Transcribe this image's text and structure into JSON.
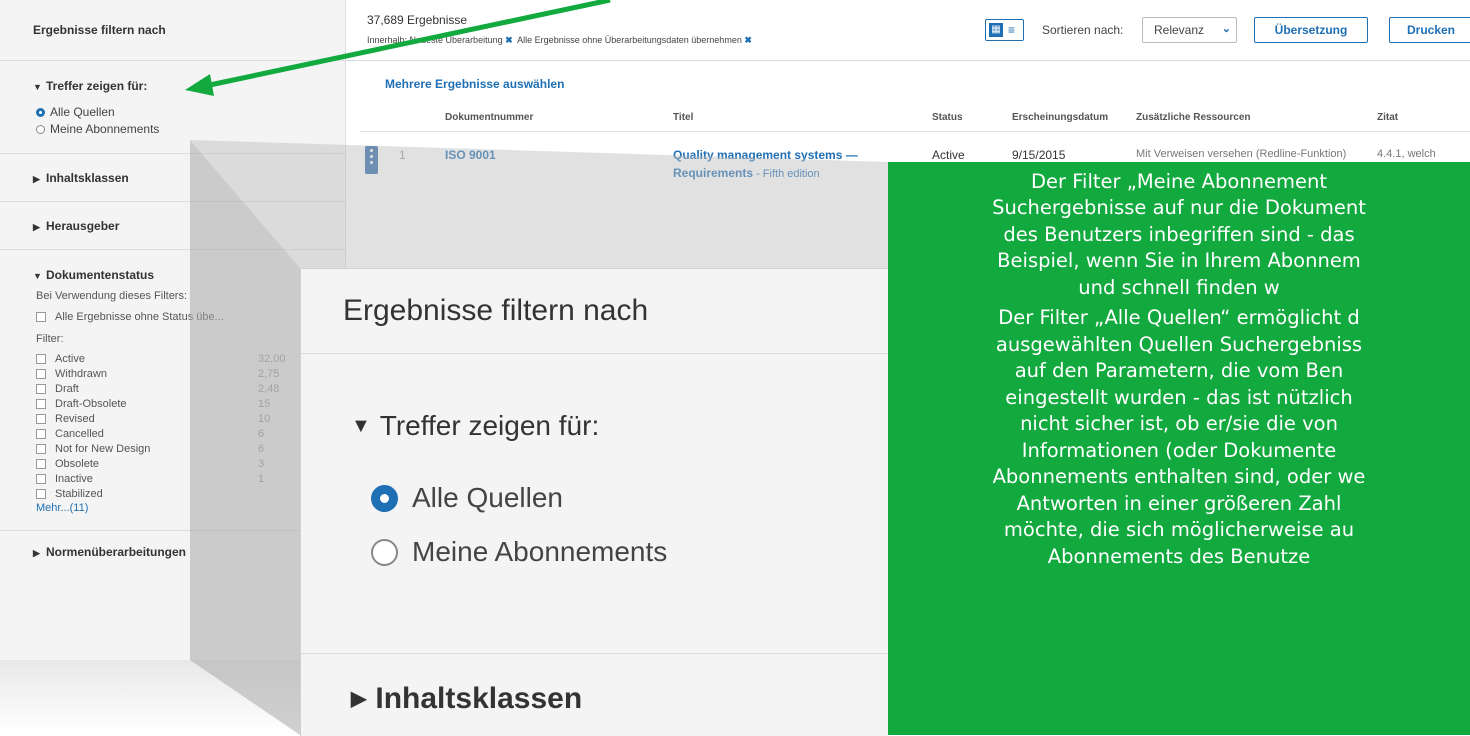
{
  "sidebar": {
    "title": "Ergebnisse filtern nach",
    "hits_section": "Treffer zeigen für:",
    "radio_all": "Alle Quellen",
    "radio_subs": "Meine Abonnements",
    "content_classes": "Inhaltsklassen",
    "publishers": "Herausgeber",
    "doc_status": "Dokumentenstatus",
    "filter_note": "Bei Verwendung dieses Filters:",
    "no_status": "Alle Ergebnisse ohne Status übe...",
    "filter_label": "Filter:",
    "status_items": [
      {
        "label": "Active",
        "count": "32,00"
      },
      {
        "label": "Withdrawn",
        "count": "2,75"
      },
      {
        "label": "Draft",
        "count": "2,48"
      },
      {
        "label": "Draft-Obsolete",
        "count": "15"
      },
      {
        "label": "Revised",
        "count": "10"
      },
      {
        "label": "Cancelled",
        "count": "6"
      },
      {
        "label": "Not for New Design",
        "count": "6"
      },
      {
        "label": "Obsolete",
        "count": "3"
      },
      {
        "label": "Inactive",
        "count": "1"
      },
      {
        "label": "Stabilized",
        "count": ""
      }
    ],
    "more": "Mehr...(11)",
    "revisions": "Normenüberarbeitungen"
  },
  "topbar": {
    "count": "37,689 Ergebnisse",
    "crumb_a": "Innerhalb: Neueste Überarbeitung",
    "crumb_b": "Alle Ergebnisse ohne Überarbeitungsdaten übernehmen",
    "sort_label": "Sortieren nach:",
    "sort_value": "Relevanz",
    "translate": "Übersetzung",
    "print": "Drucken"
  },
  "results": {
    "multi_select": "Mehrere Ergebnisse auswählen",
    "headers": {
      "docnum": "Dokumentnummer",
      "title": "Titel",
      "status": "Status",
      "date": "Erscheinungsdatum",
      "resources": "Zusätzliche Ressourcen",
      "citation": "Zitat"
    },
    "rows": [
      {
        "num": "1",
        "docnum": "ISO 9001",
        "title_a": "Quality management systems —",
        "title_b": "Requirements",
        "title_c": " - Fifth edition",
        "status": "Active",
        "date": "9/15/2015",
        "resources": "Mit Verweisen versehen (Redline-Funktion)",
        "citation": "4.4.1, welch"
      }
    ]
  },
  "zoom": {
    "title": "Ergebnisse filtern nach",
    "section": "Treffer zeigen für:",
    "radio_all": "Alle Quellen",
    "radio_subs": "Meine Abonnements",
    "next_section": "Inhaltsklassen"
  },
  "callout": {
    "lines": [
      "Der Filter „Meine Abonnement",
      "Suchergebnisse auf nur die Dokument",
      "des Benutzers inbegriffen sind - das",
      "Beispiel, wenn Sie in Ihrem Abonnem",
      "und schnell finden w",
      "Der Filter „Alle Quellen“ ermöglicht d",
      "ausgewählten Quellen Suchergebniss",
      "auf den Parametern, die vom Ben",
      "eingestellt wurden - das ist nützlich",
      "nicht sicher ist, ob er/sie die von",
      "Informationen (oder Dokumente",
      "Abonnements enthalten sind, oder we",
      "Antworten in einer größeren Zahl",
      "möchte, die sich möglicherweise au",
      "Abonnements des Benutze"
    ]
  },
  "colors": {
    "accent": "#1f6fb5",
    "callout": "#12a93f",
    "arrow": "#12a93f"
  }
}
